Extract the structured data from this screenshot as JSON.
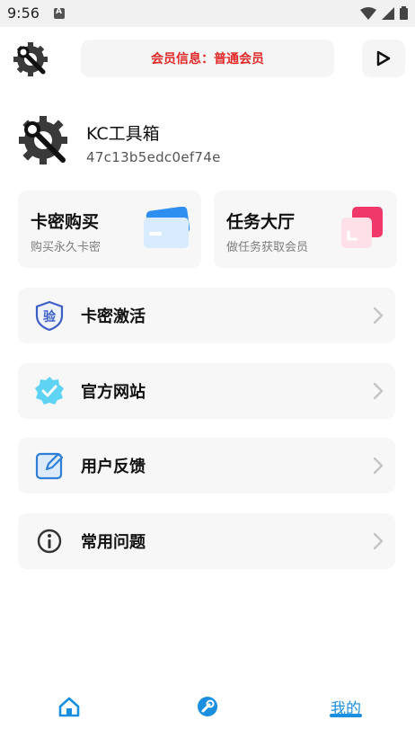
{
  "status": {
    "time": "9:56"
  },
  "header": {
    "member_info": "会员信息：普通会员"
  },
  "profile": {
    "app_name": "KC工具箱",
    "device_id": "47c13b5edc0ef74e"
  },
  "cards": [
    {
      "title": "卡密购买",
      "subtitle": "购买永久卡密"
    },
    {
      "title": "任务大厅",
      "subtitle": "做任务获取会员"
    }
  ],
  "menu": [
    {
      "label": "卡密激活",
      "icon": "shield-verify-icon",
      "icon_text": "验"
    },
    {
      "label": "官方网站",
      "icon": "verified-badge-icon"
    },
    {
      "label": "用户反馈",
      "icon": "edit-note-icon"
    },
    {
      "label": "常用问题",
      "icon": "info-icon"
    }
  ],
  "bottom_nav": {
    "home_icon": "home-icon",
    "tools_icon": "wrench-icon",
    "mine_label": "我的"
  },
  "colors": {
    "accent": "#1a8fe0",
    "member_text": "#e22929",
    "card_bg": "#f7f7f7"
  }
}
